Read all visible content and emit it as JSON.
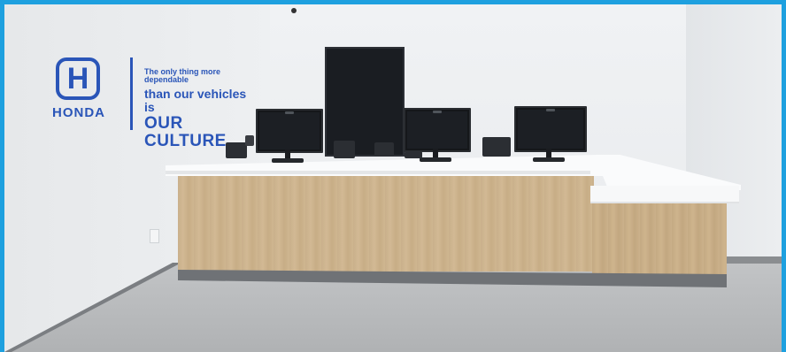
{
  "image": {
    "description_free": true
  },
  "brand": {
    "logo_icon": "honda-h-logo-icon",
    "logo_text": "HONDA",
    "color": "#2a55b8"
  },
  "slogan": {
    "line1": "The only thing more dependable",
    "line2": "than our vehicles is",
    "line3": "OUR CULTURE."
  },
  "colors": {
    "frame": "#1ea0df",
    "wall": "#eef0f2",
    "counter_wood": "#cdb38d",
    "counter_top": "#fafbfc",
    "floor": "#b8babc",
    "monitor": "#15171a"
  }
}
